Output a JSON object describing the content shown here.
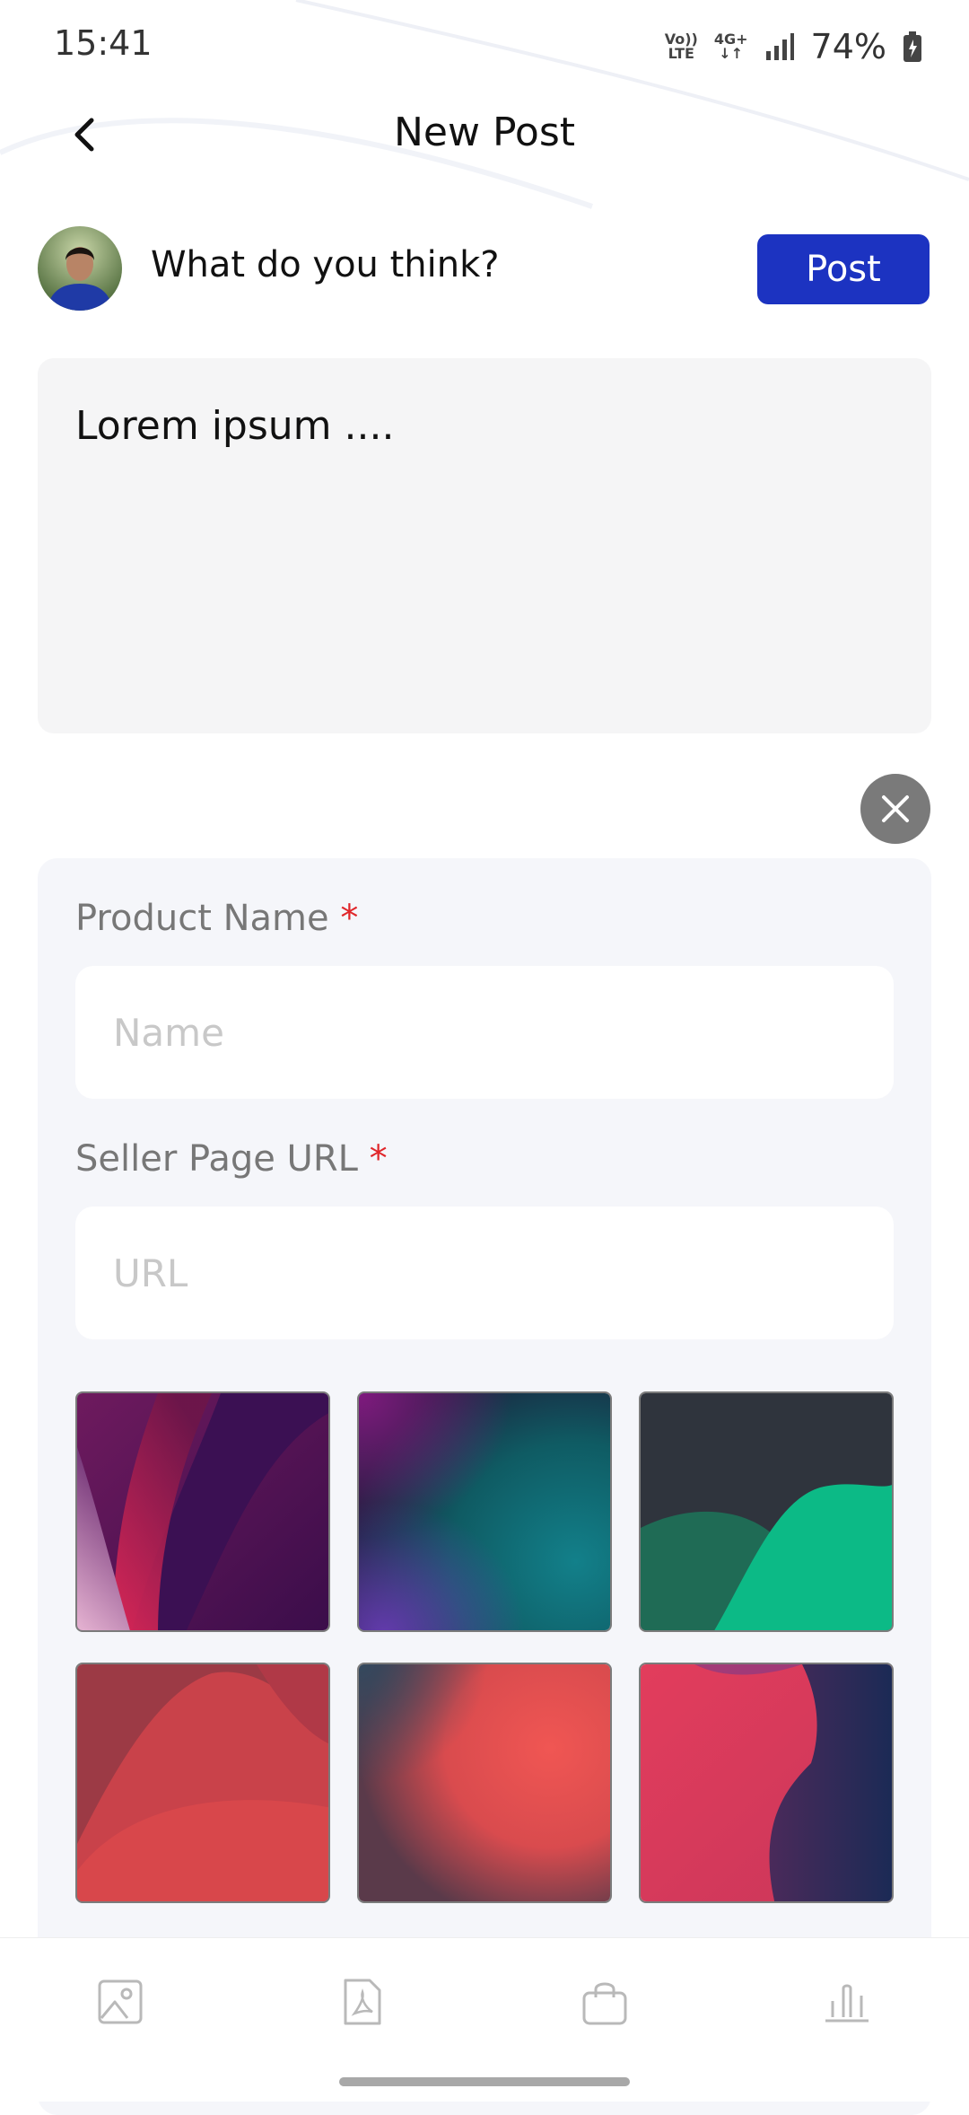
{
  "status_bar": {
    "time": "15:41",
    "network_top": "Vo))",
    "network_bottom": "LTE",
    "data_top": "4G+",
    "battery_percent": "74%"
  },
  "header": {
    "title": "New Post"
  },
  "composer": {
    "prompt": "What do you think?",
    "post_label": "Post",
    "body_text": "Lorem ipsum ...."
  },
  "product_form": {
    "name_label": "Product Name",
    "name_placeholder": "Name",
    "url_label": "Seller Page URL",
    "url_placeholder": "URL",
    "required_mark": "*"
  },
  "colors": {
    "accent": "#1c33c1",
    "required": "#e0262a",
    "card_bg": "#f5f6fa"
  },
  "bottom_nav": [
    "image-icon",
    "pdf-icon",
    "shopping-bag-icon",
    "bar-chart-icon"
  ]
}
